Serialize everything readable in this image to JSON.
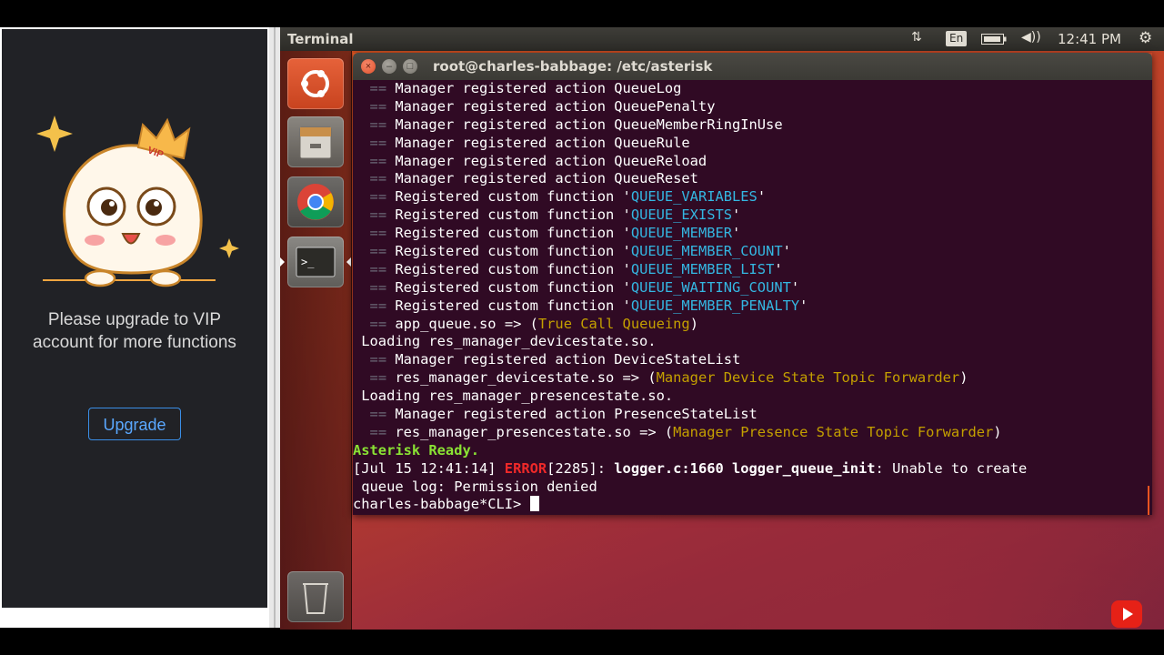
{
  "left_panel": {
    "badge_text": "VIP",
    "message": "Please upgrade to VIP account for more functions",
    "upgrade_label": "Upgrade"
  },
  "top_panel": {
    "app_name": "Terminal",
    "keyboard_layout": "En",
    "clock": "12:41 PM",
    "icons": [
      "network-icon",
      "keyboard-layout-icon",
      "battery-icon",
      "volume-icon",
      "settings-gear-icon"
    ]
  },
  "launcher": {
    "items": [
      "ubuntu-dash-icon",
      "files-icon",
      "chrome-icon",
      "terminal-icon",
      "trash-icon"
    ]
  },
  "terminal": {
    "title": "root@charles-babbage: /etc/asterisk",
    "lines": [
      [
        {
          "t": "  ",
          "c": ""
        },
        {
          "t": "==",
          "c": "eq"
        },
        {
          "t": " Manager registered action QueueLog",
          "c": ""
        }
      ],
      [
        {
          "t": "  ",
          "c": ""
        },
        {
          "t": "==",
          "c": "eq"
        },
        {
          "t": " Manager registered action QueuePenalty",
          "c": ""
        }
      ],
      [
        {
          "t": "  ",
          "c": ""
        },
        {
          "t": "==",
          "c": "eq"
        },
        {
          "t": " Manager registered action QueueMemberRingInUse",
          "c": ""
        }
      ],
      [
        {
          "t": "  ",
          "c": ""
        },
        {
          "t": "==",
          "c": "eq"
        },
        {
          "t": " Manager registered action QueueRule",
          "c": ""
        }
      ],
      [
        {
          "t": "  ",
          "c": ""
        },
        {
          "t": "==",
          "c": "eq"
        },
        {
          "t": " Manager registered action QueueReload",
          "c": ""
        }
      ],
      [
        {
          "t": "  ",
          "c": ""
        },
        {
          "t": "==",
          "c": "eq"
        },
        {
          "t": " Manager registered action QueueReset",
          "c": ""
        }
      ],
      [
        {
          "t": "  ",
          "c": ""
        },
        {
          "t": "==",
          "c": "eq"
        },
        {
          "t": " Registered custom function '",
          "c": ""
        },
        {
          "t": "QUEUE_VARIABLES",
          "c": "hl-cyan"
        },
        {
          "t": "'",
          "c": ""
        }
      ],
      [
        {
          "t": "  ",
          "c": ""
        },
        {
          "t": "==",
          "c": "eq"
        },
        {
          "t": " Registered custom function '",
          "c": ""
        },
        {
          "t": "QUEUE_EXISTS",
          "c": "hl-cyan"
        },
        {
          "t": "'",
          "c": ""
        }
      ],
      [
        {
          "t": "  ",
          "c": ""
        },
        {
          "t": "==",
          "c": "eq"
        },
        {
          "t": " Registered custom function '",
          "c": ""
        },
        {
          "t": "QUEUE_MEMBER",
          "c": "hl-cyan"
        },
        {
          "t": "'",
          "c": ""
        }
      ],
      [
        {
          "t": "  ",
          "c": ""
        },
        {
          "t": "==",
          "c": "eq"
        },
        {
          "t": " Registered custom function '",
          "c": ""
        },
        {
          "t": "QUEUE_MEMBER_COUNT",
          "c": "hl-cyan"
        },
        {
          "t": "'",
          "c": ""
        }
      ],
      [
        {
          "t": "  ",
          "c": ""
        },
        {
          "t": "==",
          "c": "eq"
        },
        {
          "t": " Registered custom function '",
          "c": ""
        },
        {
          "t": "QUEUE_MEMBER_LIST",
          "c": "hl-cyan"
        },
        {
          "t": "'",
          "c": ""
        }
      ],
      [
        {
          "t": "  ",
          "c": ""
        },
        {
          "t": "==",
          "c": "eq"
        },
        {
          "t": " Registered custom function '",
          "c": ""
        },
        {
          "t": "QUEUE_WAITING_COUNT",
          "c": "hl-cyan"
        },
        {
          "t": "'",
          "c": ""
        }
      ],
      [
        {
          "t": "  ",
          "c": ""
        },
        {
          "t": "==",
          "c": "eq"
        },
        {
          "t": " Registered custom function '",
          "c": ""
        },
        {
          "t": "QUEUE_MEMBER_PENALTY",
          "c": "hl-cyan"
        },
        {
          "t": "'",
          "c": ""
        }
      ],
      [
        {
          "t": "  ",
          "c": ""
        },
        {
          "t": "==",
          "c": "eq"
        },
        {
          "t": " app_queue.so => (",
          "c": ""
        },
        {
          "t": "True Call Queueing",
          "c": "hl-yellow"
        },
        {
          "t": ")",
          "c": ""
        }
      ],
      [
        {
          "t": " Loading res_manager_devicestate.so.",
          "c": ""
        }
      ],
      [
        {
          "t": "  ",
          "c": ""
        },
        {
          "t": "==",
          "c": "eq"
        },
        {
          "t": " Manager registered action DeviceStateList",
          "c": ""
        }
      ],
      [
        {
          "t": "  ",
          "c": ""
        },
        {
          "t": "==",
          "c": "eq"
        },
        {
          "t": " res_manager_devicestate.so => (",
          "c": ""
        },
        {
          "t": "Manager Device State Topic Forwarder",
          "c": "hl-yellow"
        },
        {
          "t": ")",
          "c": ""
        }
      ],
      [
        {
          "t": " Loading res_manager_presencestate.so.",
          "c": ""
        }
      ],
      [
        {
          "t": "  ",
          "c": ""
        },
        {
          "t": "==",
          "c": "eq"
        },
        {
          "t": " Manager registered action PresenceStateList",
          "c": ""
        }
      ],
      [
        {
          "t": "  ",
          "c": ""
        },
        {
          "t": "==",
          "c": "eq"
        },
        {
          "t": " res_manager_presencestate.so => (",
          "c": ""
        },
        {
          "t": "Manager Presence State Topic Forwarder",
          "c": "hl-yellow"
        },
        {
          "t": ")",
          "c": ""
        }
      ],
      [
        {
          "t": "Asterisk Ready.",
          "c": "hl-green"
        }
      ],
      [
        {
          "t": "[Jul 15 12:41:14] ",
          "c": ""
        },
        {
          "t": "ERROR",
          "c": "hl-red"
        },
        {
          "t": "[2285]: ",
          "c": ""
        },
        {
          "t": "logger.c:1660 logger_queue_init",
          "c": "bold"
        },
        {
          "t": ": Unable to create",
          "c": ""
        }
      ],
      [
        {
          "t": " queue log: Permission denied",
          "c": ""
        }
      ]
    ],
    "prompt": "charles-babbage*CLI> "
  },
  "video": {
    "youtube_icon": "youtube-play-icon"
  }
}
